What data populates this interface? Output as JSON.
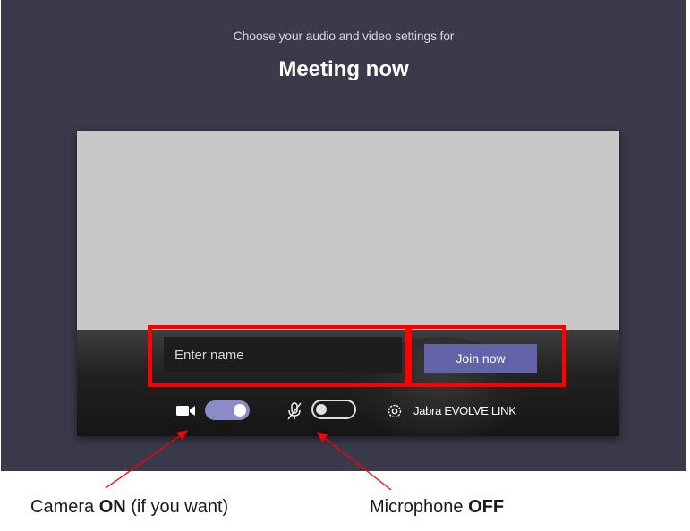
{
  "header": {
    "subtitle": "Choose your audio and video settings for",
    "title": "Meeting now"
  },
  "join_form": {
    "name_placeholder": "Enter name",
    "join_label": "Join now"
  },
  "controls": {
    "camera_on": true,
    "microphone_on": false,
    "device_name": "Jabra EVOLVE LINK"
  },
  "captions": {
    "camera_prefix": "Camera ",
    "camera_state": "ON",
    "camera_suffix": " (if you want)",
    "mic_prefix": "Microphone ",
    "mic_state": "OFF"
  },
  "colors": {
    "background": "#3b3a4a",
    "accent": "#6264a7",
    "toggle_on": "#8b8cc7",
    "annotation": "#ff0000"
  }
}
